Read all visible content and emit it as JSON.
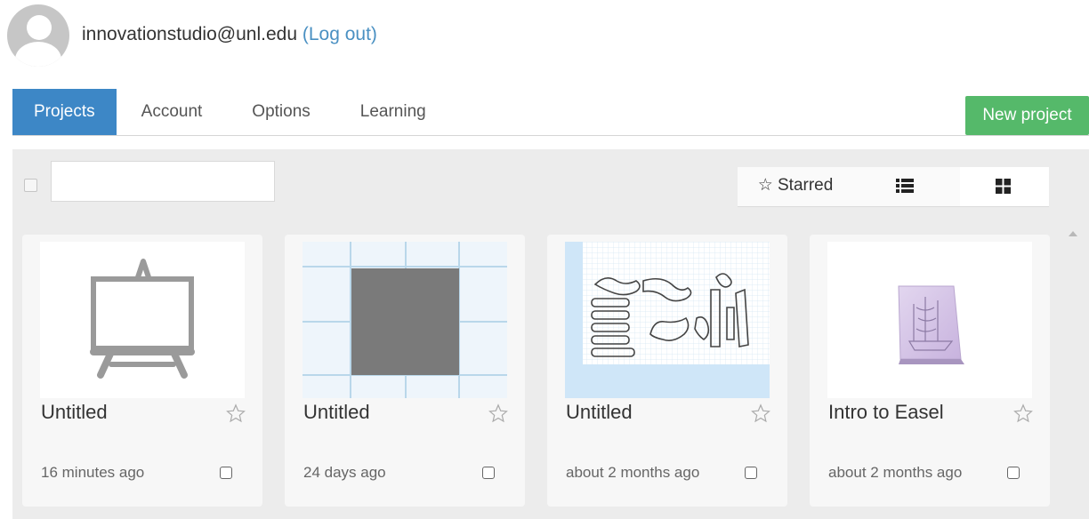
{
  "user": {
    "email": "innovationstudio@unl.edu",
    "logout": "(Log out)"
  },
  "tabs": [
    {
      "label": "Projects",
      "active": true
    },
    {
      "label": "Account",
      "active": false
    },
    {
      "label": "Options",
      "active": false
    },
    {
      "label": "Learning",
      "active": false
    }
  ],
  "new_project": "New project",
  "search": {
    "placeholder": "",
    "value": ""
  },
  "view": {
    "starred_label": "☆ Starred",
    "list_icon": "list-view-icon",
    "grid_icon": "grid-view-icon",
    "active": "grid"
  },
  "colors": {
    "active_tab": "#3d87c6",
    "new_button": "#55b96a",
    "link": "#4a90c2"
  },
  "projects": [
    {
      "title": "Untitled",
      "date": "16 minutes ago",
      "thumbnail": "easel-icon",
      "starred": false
    },
    {
      "title": "Untitled",
      "date": "24 days ago",
      "thumbnail": "grey-square-on-grid",
      "starred": false
    },
    {
      "title": "Untitled",
      "date": "about 2 months ago",
      "thumbnail": "cut-parts-layout",
      "starred": false
    },
    {
      "title": "Intro to Easel",
      "date": "about 2 months ago",
      "thumbnail": "ship-relief-carving",
      "starred": false
    }
  ]
}
